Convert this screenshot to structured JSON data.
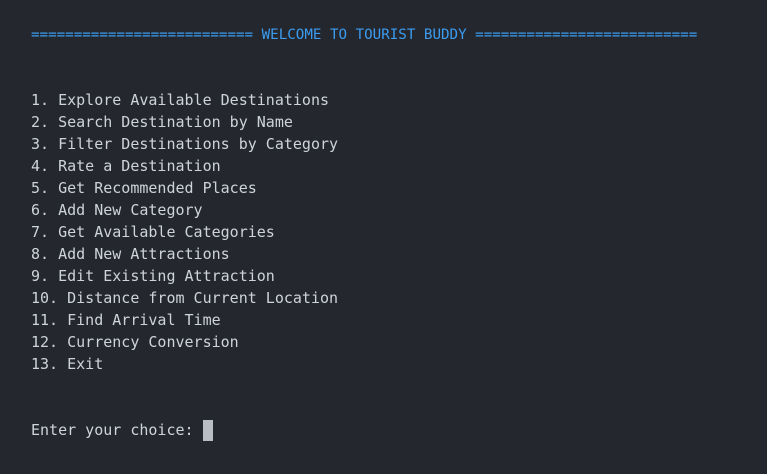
{
  "terminal": {
    "banner": "========================== WELCOME TO TOURIST BUDDY ==========================",
    "menu_items": [
      "1. Explore Available Destinations",
      "2. Search Destination by Name",
      "3. Filter Destinations by Category",
      "4. Rate a Destination",
      "5. Get Recommended Places",
      "6. Add New Category",
      "7. Get Available Categories",
      "8. Add New Attractions",
      "9. Edit Existing Attraction",
      "10. Distance from Current Location",
      "11. Find Arrival Time",
      "12. Currency Conversion",
      "13. Exit"
    ],
    "prompt": "Enter your choice:"
  },
  "colors": {
    "background": "#24272e",
    "text": "#cfd3da",
    "banner": "#3b9cf0",
    "cursor": "#b9bec6"
  }
}
